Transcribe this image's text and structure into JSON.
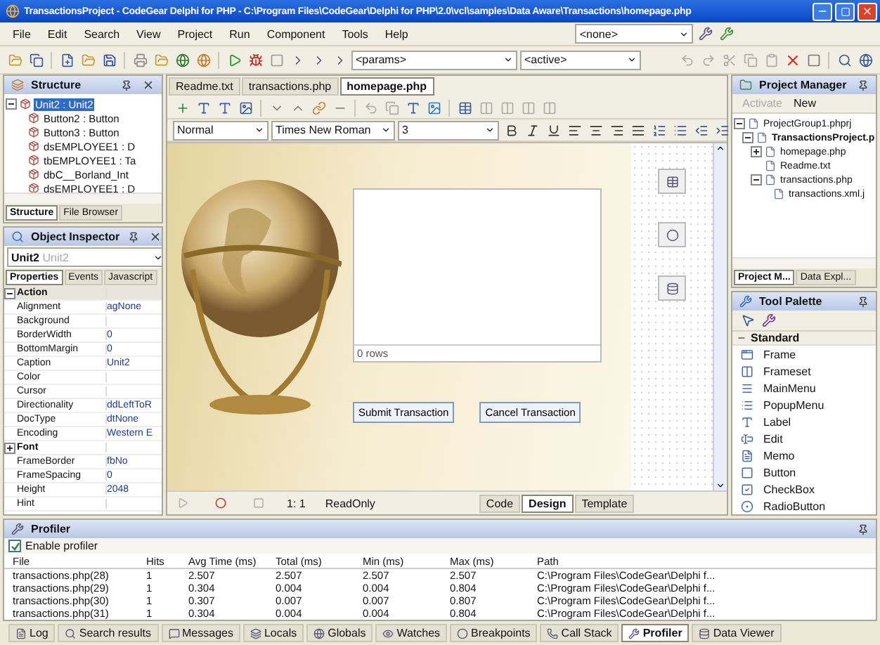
{
  "window": {
    "title": "TransactionsProject - CodeGear Delphi for PHP - C:\\Program Files\\CodeGear\\Delphi for PHP\\2.0\\vcl\\samples\\Data Aware\\Transactions\\homepage.php"
  },
  "menu": [
    "File",
    "Edit",
    "Search",
    "View",
    "Project",
    "Run",
    "Component",
    "Tools",
    "Help"
  ],
  "menu_combo": {
    "value": "<none>"
  },
  "toolbar": {
    "params_combo": "<params>",
    "active_combo": "<active>"
  },
  "structure": {
    "title": "Structure",
    "tree": [
      {
        "label": "Unit2 : Unit2",
        "selected": true,
        "expanded": true,
        "children": [
          {
            "label": "Button2 : Button",
            "selected": false
          },
          {
            "label": "Button3 : Button",
            "selected": false
          },
          {
            "label": "dsEMPLOYEE1 : D",
            "selected": false
          },
          {
            "label": "tbEMPLOYEE1 : Ta",
            "selected": false
          },
          {
            "label": "dbC__Borland_Int",
            "selected": false
          },
          {
            "label": "dsEMPLOYEE1 : D",
            "selected": false
          }
        ]
      }
    ],
    "tabs": [
      {
        "label": "Structure",
        "selected": true
      },
      {
        "label": "File Browser",
        "selected": false
      }
    ]
  },
  "object_inspector": {
    "title": "Object Inspector",
    "object": "Unit2",
    "object_type": "Unit2",
    "tabs": [
      {
        "label": "Properties",
        "selected": true
      },
      {
        "label": "Events",
        "selected": false
      },
      {
        "label": "Javascript",
        "selected": false
      }
    ],
    "properties": [
      {
        "kind": "group",
        "name": "Action",
        "selected": true,
        "expanded": true
      },
      {
        "kind": "property",
        "name": "Alignment",
        "value": "agNone",
        "selected": false
      },
      {
        "kind": "property",
        "name": "Background",
        "selected": false
      },
      {
        "kind": "property",
        "name": "BorderWidth",
        "value": "0",
        "selected": false
      },
      {
        "kind": "property",
        "name": "BottomMargin",
        "value": "0",
        "selected": false
      },
      {
        "kind": "property",
        "name": "Caption",
        "value": "Unit2",
        "selected": false
      },
      {
        "kind": "property",
        "name": "Color",
        "selected": false
      },
      {
        "kind": "property",
        "name": "Cursor",
        "selected": false
      },
      {
        "kind": "property",
        "name": "Directionality",
        "value": "ddLeftToR",
        "selected": false
      },
      {
        "kind": "property",
        "name": "DocType",
        "value": "dtNone",
        "selected": false
      },
      {
        "kind": "property",
        "name": "Encoding",
        "value": "Western E",
        "selected": false
      },
      {
        "kind": "group",
        "name": "Font",
        "selected": false,
        "expanded": false
      },
      {
        "kind": "property",
        "name": "FrameBorder",
        "value": "fbNo",
        "selected": false
      },
      {
        "kind": "property",
        "name": "FrameSpacing",
        "value": "0",
        "selected": false
      },
      {
        "kind": "property",
        "name": "Height",
        "value": "2048",
        "selected": false
      },
      {
        "kind": "property",
        "name": "Hint",
        "selected": false
      }
    ]
  },
  "editor": {
    "tabs": [
      {
        "label": "Readme.txt",
        "selected": false
      },
      {
        "label": "transactions.php",
        "selected": false
      },
      {
        "label": "homepage.php",
        "selected": true
      }
    ],
    "format": {
      "style": "Normal",
      "font": "Times New Roman",
      "size": "3"
    },
    "grid": {
      "caption": "0 rows"
    },
    "buttons": [
      "Submit Transaction",
      "Cancel Transaction"
    ],
    "status": {
      "position": "1: 1",
      "mode": "ReadOnly"
    },
    "views": [
      {
        "label": "Code",
        "selected": false
      },
      {
        "label": "Design",
        "selected": true
      },
      {
        "label": "Template",
        "selected": false
      }
    ]
  },
  "project_manager": {
    "title": "Project Manager",
    "actions": [
      {
        "label": "Activate",
        "disabled": true
      },
      {
        "label": "New",
        "disabled": false
      }
    ],
    "tree": [
      {
        "label": "ProjectGroup1.phprj",
        "bold": false,
        "expanded": true,
        "children": [
          {
            "label": "TransactionsProject.p",
            "bold": true,
            "expanded": true,
            "children": [
              {
                "label": "homepage.php",
                "bold": false,
                "expanded": false
              },
              {
                "label": "Readme.txt",
                "bold": false
              },
              {
                "label": "transactions.php",
                "bold": false,
                "expanded": true,
                "children": [
                  {
                    "label": "transactions.xml.j",
                    "bold": false
                  }
                ]
              }
            ]
          }
        ]
      }
    ],
    "tabs": [
      {
        "label": "Project M...",
        "selected": true
      },
      {
        "label": "Data Expl...",
        "selected": false
      }
    ]
  },
  "tool_palette": {
    "title": "Tool Palette",
    "category": {
      "label": "Standard",
      "expanded": true
    },
    "items": [
      "Frame",
      "Frameset",
      "MainMenu",
      "PopupMenu",
      "Label",
      "Edit",
      "Memo",
      "Button",
      "CheckBox",
      "RadioButton"
    ]
  },
  "profiler": {
    "title": "Profiler",
    "enable": {
      "label": "Enable profiler",
      "checked": true
    },
    "columns": [
      "File",
      "Hits",
      "Avg Time (ms)",
      "Total (ms)",
      "Min (ms)",
      "Max (ms)",
      "Path"
    ],
    "rows": [
      [
        "transactions.php(28)",
        "1",
        "2.507",
        "2.507",
        "2.507",
        "2.507",
        "C:\\Program Files\\CodeGear\\Delphi f..."
      ],
      [
        "transactions.php(29)",
        "1",
        "0.304",
        "0.004",
        "0.004",
        "0.804",
        "C:\\Program Files\\CodeGear\\Delphi f..."
      ],
      [
        "transactions.php(30)",
        "1",
        "0.307",
        "0.007",
        "0.007",
        "0.807",
        "C:\\Program Files\\CodeGear\\Delphi f..."
      ],
      [
        "transactions.php(31)",
        "1",
        "0.304",
        "0.004",
        "0.004",
        "0.804",
        "C:\\Program Files\\CodeGear\\Delphi f..."
      ]
    ]
  },
  "bottom_tabs": [
    {
      "label": "Log",
      "selected": false
    },
    {
      "label": "Search results",
      "selected": false
    },
    {
      "label": "Messages",
      "selected": false
    },
    {
      "label": "Locals",
      "selected": false
    },
    {
      "label": "Globals",
      "selected": false
    },
    {
      "label": "Watches",
      "selected": false
    },
    {
      "label": "Breakpoints",
      "selected": false
    },
    {
      "label": "Call Stack",
      "selected": false
    },
    {
      "label": "Profiler",
      "selected": true
    },
    {
      "label": "Data Viewer",
      "selected": false
    }
  ]
}
